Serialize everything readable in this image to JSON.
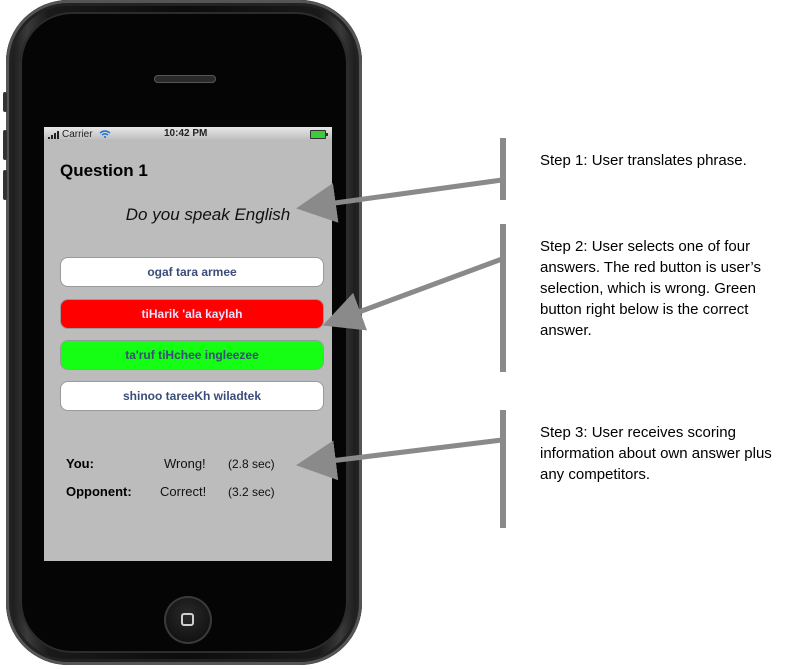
{
  "phone": {
    "status_bar": {
      "carrier": "Carrier",
      "time": "10:42 PM"
    },
    "question_title": "Question 1",
    "phrase": "Do you speak English",
    "answers": [
      {
        "label": "ogaf tara armee",
        "state": "normal",
        "color": "#ffffff"
      },
      {
        "label": "tiHarik 'ala kaylah",
        "state": "selected-wrong",
        "color": "#ff0000"
      },
      {
        "label": "ta'ruf tiHchee ingleezee",
        "state": "correct",
        "color": "#14ff14"
      },
      {
        "label": "shinoo tareeKh wiladtek",
        "state": "normal",
        "color": "#ffffff"
      }
    ],
    "scores": [
      {
        "label": "You:",
        "result": "Wrong!",
        "time": "(2.8 sec)"
      },
      {
        "label": "Opponent:",
        "result": "Correct!",
        "time": "(3.2 sec)"
      }
    ]
  },
  "callouts": [
    "Step 1: User translates phrase.",
    "Step 2: User selects one of four answers. The red button is user’s selection, which is wrong. Green button right below is the correct answer.",
    "Step 3: User receives scoring information about own answer plus any competitors."
  ]
}
